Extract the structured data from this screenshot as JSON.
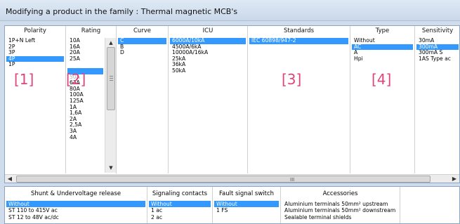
{
  "window": {
    "title": "Modifying a product in the family : Thermal magnetic MCB's"
  },
  "columns": {
    "polarity": {
      "header": "Polarity",
      "items": [
        "1P+N Left",
        "2P",
        "3P",
        "4P",
        "1P"
      ],
      "selected": "4P"
    },
    "rating": {
      "header": "Rating",
      "items": [
        "10A",
        "16A",
        "20A",
        "25A",
        "",
        "",
        "50A",
        "63A",
        "80A",
        "100A",
        "125A",
        "1A",
        "1,6A",
        "2A",
        "2,5A",
        "3A",
        "4A"
      ],
      "selected_index": 5
    },
    "curve": {
      "header": "Curve",
      "items": [
        "C",
        "B",
        "D"
      ],
      "selected": "C"
    },
    "icu": {
      "header": "ICU",
      "items": [
        "6000A/10kA",
        "4500A/6kA",
        "10000A/16kA",
        "25kA",
        "36kA",
        "50kA"
      ],
      "selected": "6000A/10kA"
    },
    "standards": {
      "header": "Standards",
      "items": [
        "IEC 60898/947-2"
      ],
      "selected": "IEC 60898/947-2"
    },
    "type": {
      "header": "Type",
      "items": [
        "Without",
        "AC",
        "A",
        "Hpi"
      ],
      "selected": "AC"
    },
    "sensitivity": {
      "header": "Sensitivity",
      "items": [
        "30mA",
        "300mA",
        "300mA S",
        "1AS Type ac"
      ],
      "selected": "300mA"
    }
  },
  "annotations": [
    "[1]",
    "[2]",
    "[3]",
    "[4]"
  ],
  "scrollbars": {
    "up_arrow": "▲",
    "down_arrow": "▼",
    "left_arrow": "◀",
    "right_arrow": "▶",
    "h_grip": "III"
  },
  "bottom": {
    "shunt": {
      "header": "Shunt & Undervoltage release",
      "items": [
        "Without",
        "ST 110 to  415V ac",
        "ST 12 to 48V  ac/dc"
      ],
      "selected": "Without"
    },
    "signaling": {
      "header": "Signaling contacts",
      "items": [
        "Without",
        "1 ac",
        "2 ac"
      ],
      "selected": "Without"
    },
    "fault": {
      "header": "Fault signal switch",
      "items": [
        "Without",
        "1 FS"
      ],
      "selected": "Without"
    },
    "accessories": {
      "header": "Accessories",
      "items": [
        "Aluminium terminals 50mm² upstream",
        "Aluminium terminals 50mm² downstream",
        "Sealable terminal shields"
      ]
    }
  },
  "colors": {
    "selection": "#3399ff",
    "annotation": "#e0447c",
    "frame": "#cfdcec"
  }
}
